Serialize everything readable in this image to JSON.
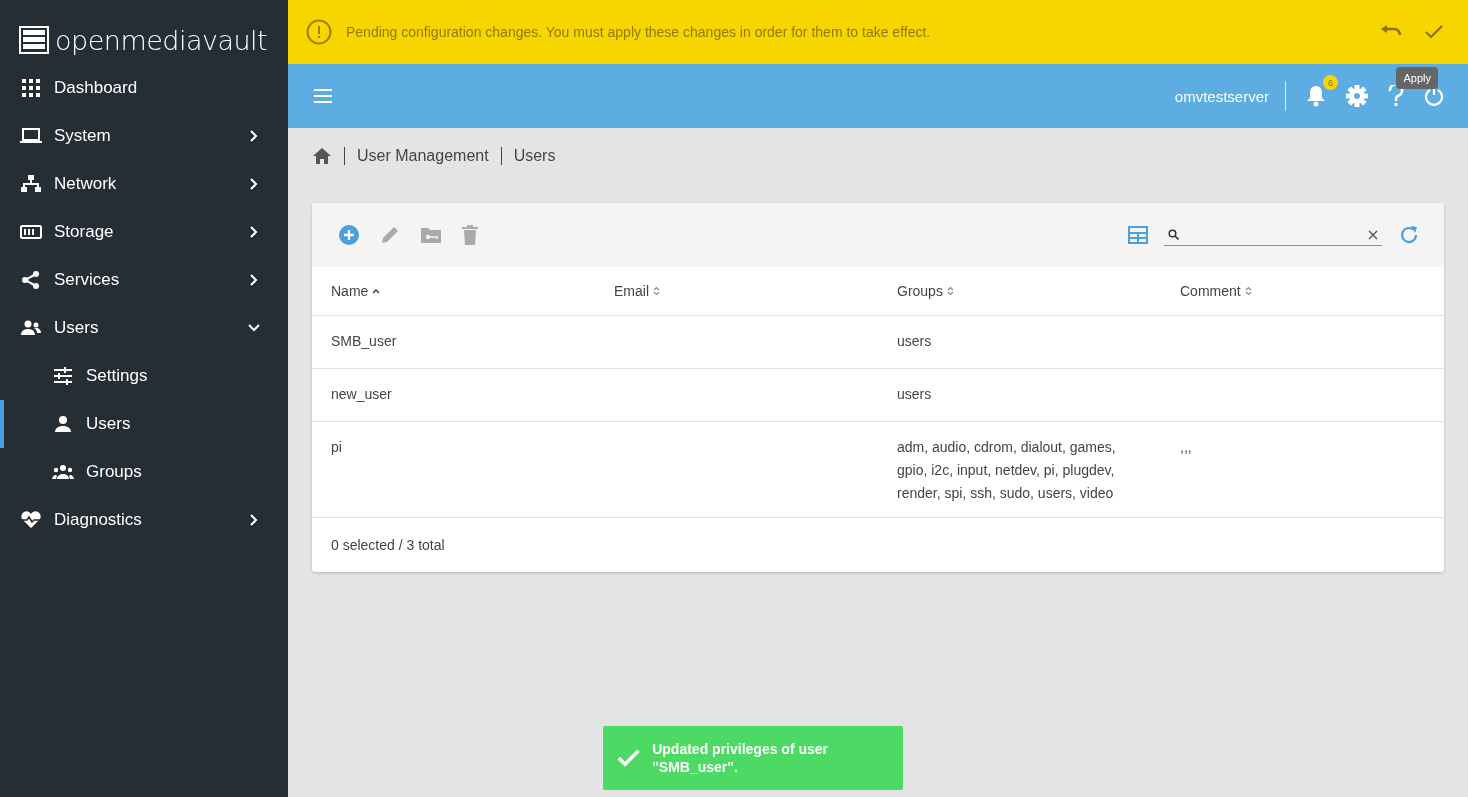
{
  "logo": {
    "text": "openmediavault"
  },
  "sidebar": {
    "items": [
      {
        "label": "Dashboard",
        "kind": "link",
        "selected": false
      },
      {
        "label": "System",
        "kind": "group",
        "expanded": false,
        "selected": false
      },
      {
        "label": "Network",
        "kind": "group",
        "expanded": false,
        "selected": false
      },
      {
        "label": "Storage",
        "kind": "group",
        "expanded": false,
        "selected": false
      },
      {
        "label": "Services",
        "kind": "group",
        "expanded": false,
        "selected": false
      },
      {
        "label": "Users",
        "kind": "group",
        "expanded": true,
        "selected": false,
        "children": [
          {
            "label": "Settings",
            "selected": false
          },
          {
            "label": "Users",
            "selected": true
          },
          {
            "label": "Groups",
            "selected": false
          }
        ]
      },
      {
        "label": "Diagnostics",
        "kind": "group",
        "expanded": false,
        "selected": false
      }
    ]
  },
  "banner": {
    "message": "Pending configuration changes. You must apply these changes in order for them to take effect.",
    "tooltip": "Apply"
  },
  "header": {
    "hostname": "omvtestserver",
    "notification_count": "6"
  },
  "breadcrumb": [
    "User Management",
    "Users"
  ],
  "table": {
    "columns": [
      {
        "label": "Name",
        "sorted": true
      },
      {
        "label": "Email",
        "sorted": false
      },
      {
        "label": "Groups",
        "sorted": false
      },
      {
        "label": "Comment",
        "sorted": false
      }
    ],
    "rows": [
      {
        "name": "SMB_user",
        "groups": "users"
      },
      {
        "name": "new_user",
        "groups": "users"
      },
      {
        "name": "pi",
        "groups": "adm, audio, cdrom, dialout, games, gpio, i2c, input, netdev, pi, plugdev, render, spi, ssh, sudo, users, video",
        "comment": ",,,"
      }
    ],
    "footer": "0 selected / 3 total"
  },
  "toast": {
    "message": "Updated privileges of user \"SMB_user\"."
  }
}
